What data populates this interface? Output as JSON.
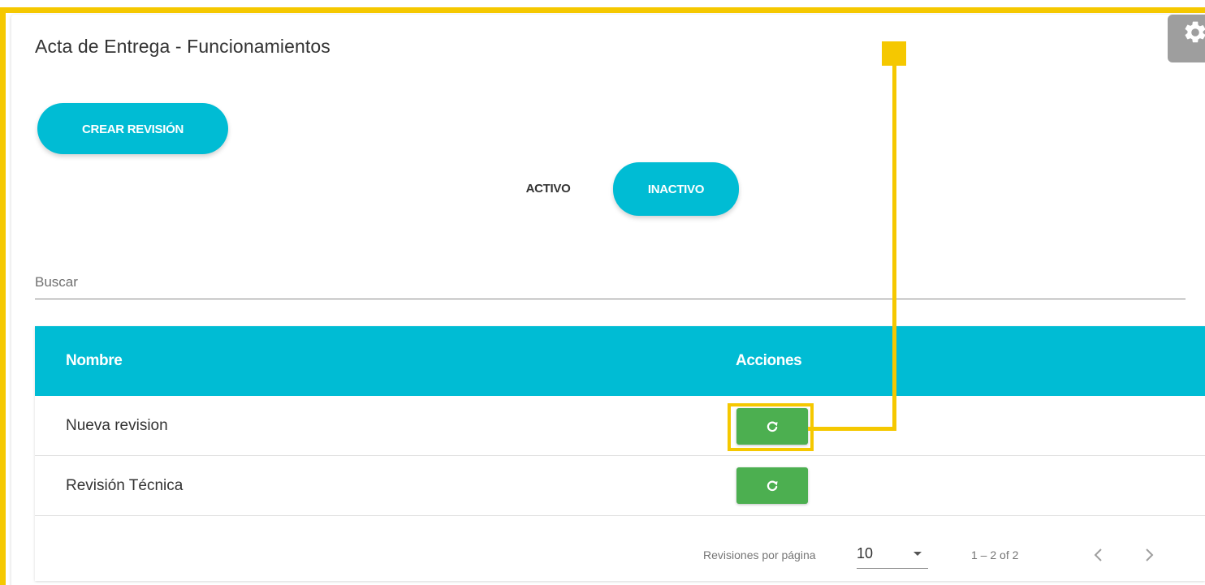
{
  "page": {
    "title": "Acta de Entrega - Funcionamientos"
  },
  "actions": {
    "create_label": "CREAR REVISIÓN"
  },
  "tabs": [
    {
      "label": "ACTIVO",
      "selected": false
    },
    {
      "label": "INACTIVO",
      "selected": true
    }
  ],
  "search": {
    "placeholder": "Buscar",
    "value": ""
  },
  "table": {
    "columns": [
      "Nombre",
      "Acciones"
    ],
    "rows": [
      {
        "name": "Nueva revision",
        "action_icon": "restore-icon"
      },
      {
        "name": "Revisión Técnica",
        "action_icon": "restore-icon"
      }
    ]
  },
  "pagination": {
    "per_page_label": "Revisiones por página",
    "per_page_value": "10",
    "range_label": "1 – 2 of 2",
    "prev_icon": "chevron-left-icon",
    "next_icon": "chevron-right-icon"
  },
  "colors": {
    "accent": "#00bcd4",
    "action_button": "#4caf50",
    "annotation": "#f5c800",
    "settings_tab": "#9e9e9e"
  },
  "icons": {
    "settings": "gear-icon"
  }
}
